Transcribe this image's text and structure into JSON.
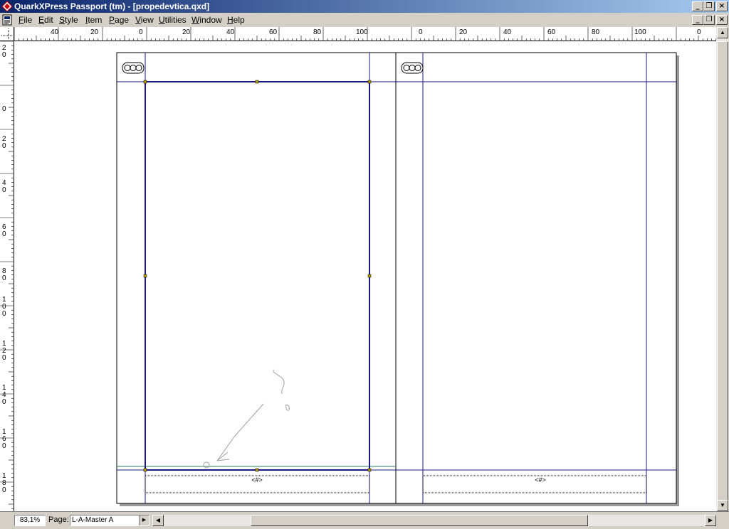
{
  "window": {
    "title": "QuarkXPress Passport (tm) - [propedevtica.qxd]",
    "minimize_glyph": "_",
    "restore_glyph": "❐",
    "close_glyph": "×"
  },
  "menubar": {
    "items": [
      {
        "label": "File",
        "accel": "F"
      },
      {
        "label": "Edit",
        "accel": "E"
      },
      {
        "label": "Style",
        "accel": "S"
      },
      {
        "label": "Item",
        "accel": "I"
      },
      {
        "label": "Page",
        "accel": "P"
      },
      {
        "label": "View",
        "accel": "V"
      },
      {
        "label": "Utilities",
        "accel": "U"
      },
      {
        "label": "Window",
        "accel": "W"
      },
      {
        "label": "Help",
        "accel": "H"
      }
    ]
  },
  "ruler": {
    "h_labels_left": [
      "40",
      "20",
      "0",
      "20",
      "40",
      "60",
      "80",
      "100"
    ],
    "h_labels_right": [
      "0",
      "20",
      "40",
      "60",
      "80",
      "100",
      "0"
    ],
    "v_labels": [
      "20",
      "0",
      "20",
      "40",
      "60",
      "80",
      "100",
      "120",
      "140",
      "160",
      "180"
    ]
  },
  "spread": {
    "left_page_footer_marker": "<#>",
    "right_page_footer_marker": "<#>"
  },
  "status": {
    "zoom": "83,1%",
    "page_label": "Page:",
    "page_value": "L-A-Master A"
  },
  "colors": {
    "guide_blue": "#1a1a8c",
    "bleed_green": "#2e7d5b",
    "titlebar_start": "#0a246a",
    "titlebar_end": "#a6caf0"
  }
}
